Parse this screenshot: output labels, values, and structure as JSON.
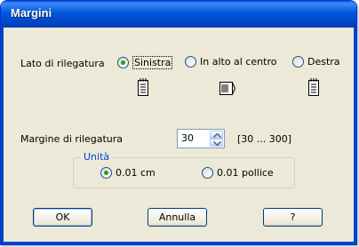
{
  "window": {
    "title": "Margini"
  },
  "binding_side": {
    "label": "Lato di rilegatura",
    "options": [
      {
        "label": "Sinistra",
        "selected": true
      },
      {
        "label": "In alto al centro",
        "selected": false
      },
      {
        "label": "Destra",
        "selected": false
      }
    ]
  },
  "gutter": {
    "label": "Margine di rilegatura",
    "value": "30",
    "range": "[30 ... 300]"
  },
  "units": {
    "title": "Unità",
    "options": [
      {
        "label": "0.01 cm",
        "selected": true
      },
      {
        "label": "0.01 pollice",
        "selected": false
      }
    ]
  },
  "buttons": {
    "ok": "OK",
    "cancel": "Annulla",
    "help": "?"
  },
  "colors": {
    "title_bar": "#0054e3",
    "dialog_bg": "#ece9d8",
    "radio_dot": "#21a121",
    "group_title": "#0046d5"
  }
}
